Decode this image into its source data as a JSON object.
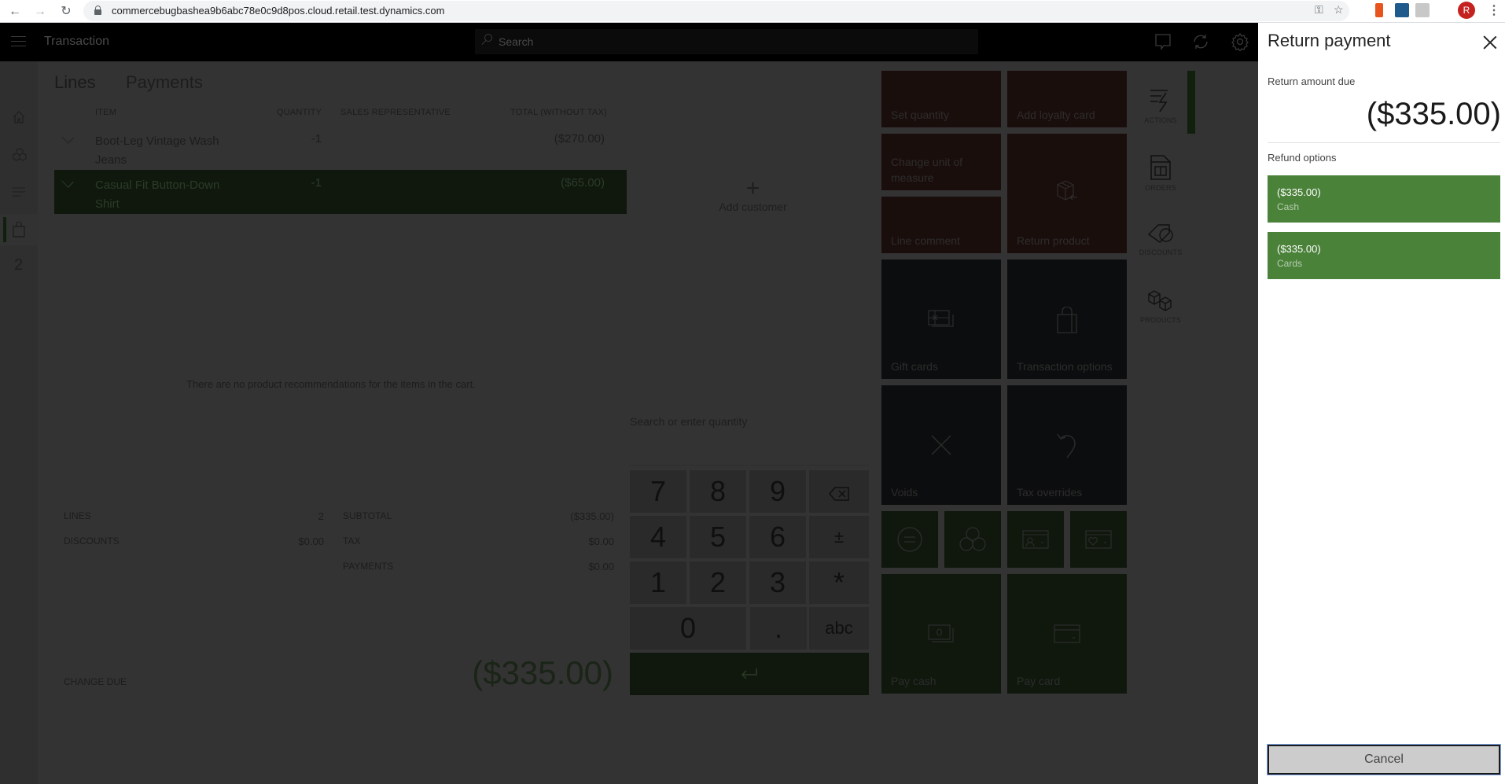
{
  "browser": {
    "url": "commercebugbashea9b6abc78e0c9d8pos.cloud.retail.test.dynamics.com",
    "profile_initial": "R"
  },
  "header": {
    "title": "Transaction",
    "search_placeholder": "Search"
  },
  "left_nav": {
    "items": [
      {
        "name": "home-icon"
      },
      {
        "name": "products-icon"
      },
      {
        "name": "menu-list-icon"
      },
      {
        "name": "shopping-bag-icon",
        "active": true
      },
      {
        "name": "count",
        "label": "2"
      }
    ]
  },
  "tabs": [
    {
      "label": "Lines",
      "active": true
    },
    {
      "label": "Payments",
      "active": false
    }
  ],
  "lines_table": {
    "columns": [
      "ITEM",
      "QUANTITY",
      "SALES REPRESENTATIVE",
      "TOTAL (WITHOUT TAX)"
    ],
    "rows": [
      {
        "item": "Boot-Leg Vintage Wash Jeans",
        "quantity": "-1",
        "sales_rep": "",
        "total": "($270.00)",
        "selected": false
      },
      {
        "item": "Casual Fit Button-Down Shirt",
        "quantity": "-1",
        "sales_rep": "",
        "total": "($65.00)",
        "selected": true
      }
    ]
  },
  "recommendations": {
    "empty_text": "There are no product recommendations for the items in the cart."
  },
  "totals": {
    "lines_label": "LINES",
    "lines_value": "2",
    "discounts_label": "DISCOUNTS",
    "discounts_value": "$0.00",
    "subtotal_label": "SUBTOTAL",
    "subtotal_value": "($335.00)",
    "tax_label": "TAX",
    "tax_value": "$0.00",
    "payments_label": "PAYMENTS",
    "payments_value": "$0.00",
    "change_due_label": "CHANGE DUE",
    "change_due_value": "($335.00)"
  },
  "customer": {
    "add_label": "Add customer"
  },
  "numpad": {
    "placeholder": "Search or enter quantity",
    "keys": [
      "7",
      "8",
      "9",
      "backspace",
      "4",
      "5",
      "6",
      "±",
      "1",
      "2",
      "3",
      "*",
      "0",
      ".",
      "abc"
    ]
  },
  "tiles": {
    "set_quantity": "Set quantity",
    "add_loyalty_card": "Add loyalty card",
    "change_unit": "Change unit of measure",
    "line_comment": "Line comment",
    "return_product": "Return product",
    "gift_cards": "Gift cards",
    "transaction_options": "Transaction options",
    "voids": "Voids",
    "tax_overrides": "Tax overrides",
    "pay_cash": "Pay cash",
    "pay_card": "Pay card"
  },
  "right_nav": {
    "actions": "ACTIONS",
    "orders": "ORDERS",
    "discounts": "DISCOUNTS",
    "products": "PRODUCTS"
  },
  "return_panel": {
    "title": "Return payment",
    "amount_due_label": "Return amount due",
    "amount_due": "($335.00)",
    "refund_options_label": "Refund options",
    "options": [
      {
        "amount": "($335.00)",
        "method": "Cash"
      },
      {
        "amount": "($335.00)",
        "method": "Cards"
      }
    ],
    "cancel_label": "Cancel"
  },
  "colors": {
    "accent_green": "#4b823a",
    "overlay_background": "#333333",
    "panel_background": "#ffffff"
  }
}
